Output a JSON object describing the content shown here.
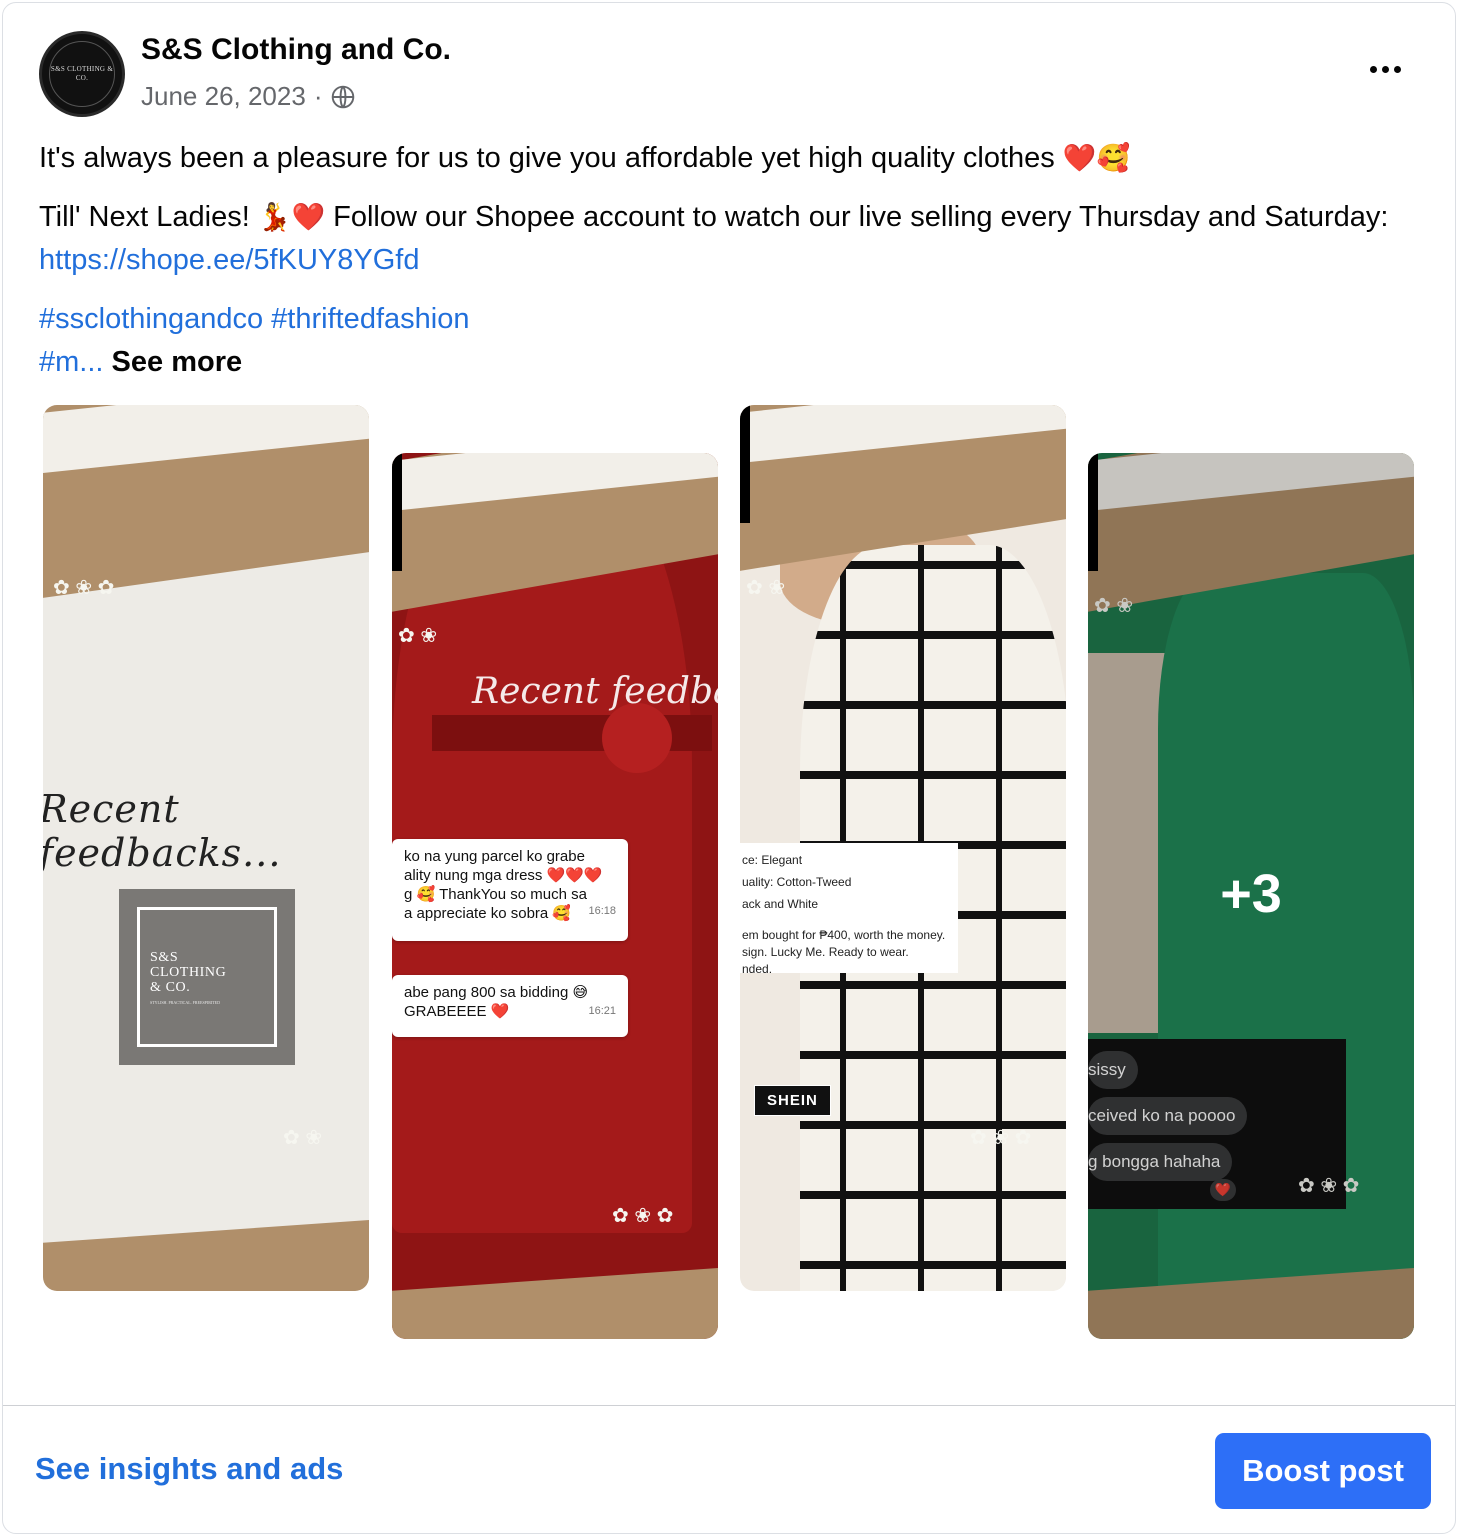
{
  "post": {
    "page_name": "S&S Clothing and Co.",
    "avatar_text": "S&S CLOTHING & CO.",
    "date": "June 26, 2023",
    "separator": "·",
    "privacy_icon": "globe-icon",
    "more_icon": "more-horizontal-icon",
    "paragraph1": "It's always been a pleasure for us to give you affordable yet high quality clothes",
    "paragraph1_emoji": "❤️🥰",
    "paragraph2_start": "Till' Next Ladies!",
    "paragraph2_emoji": "💃❤️",
    "paragraph2_rest": "Follow our Shopee account to watch our live selling every Thursday and Saturday:",
    "link": "https://shope.ee/5fKUY8YGfd",
    "hashtags_line1": "#ssclothingandco #thriftedfashion",
    "hashtags_truncated": "#m...",
    "see_more": "See more"
  },
  "gallery": {
    "tile1": {
      "script_text": "Recent feedbacks...",
      "logo_lines": [
        "S&S",
        "CLOTHING",
        "& CO."
      ],
      "logo_tagline": "STYLISH. PRACTICAL. FREESPIRITED"
    },
    "tile2": {
      "script_text": "Recent feedbacks",
      "chat1_lines": [
        "ko na yung parcel ko grabe",
        "ality nung mga dress ❤️❤️❤️",
        "g 🥰 ThankYou so much sa",
        "a appreciate ko sobra 🥰"
      ],
      "chat1_time": "16:18",
      "chat2_lines": [
        "abe pang 800 sa bidding 😅",
        "GRABEEEE ❤️"
      ],
      "chat2_time": "16:21"
    },
    "tile3": {
      "review_lines": [
        "ce: Elegant",
        "uality: Cotton-Tweed",
        "ack and White",
        "",
        "em bought for ₱400, worth the money.",
        "sign. Lucky Me. Ready to wear.",
        "nded."
      ],
      "brand_label": "SHEIN"
    },
    "tile4": {
      "dm_lines": [
        "sissy",
        "ceived ko na poooo",
        "g bongga hahaha"
      ],
      "dm_heart": "❤️",
      "more_count": "+3"
    }
  },
  "footer": {
    "insights_label": "See insights and ads",
    "boost_label": "Boost post"
  },
  "colors": {
    "link": "#216fdb",
    "boost_button": "#2d6ff7",
    "meta_text": "#65676b"
  }
}
